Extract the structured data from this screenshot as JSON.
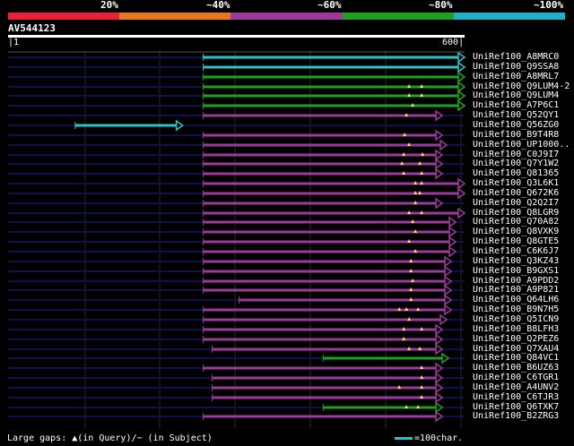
{
  "legend": {
    "segments": [
      {
        "label": "20%",
        "color": "#e8203a"
      },
      {
        "label": "~40%",
        "color": "#e87820"
      },
      {
        "label": "~60%",
        "color": "#9a3a9a"
      },
      {
        "label": "~80%",
        "color": "#20a020"
      },
      {
        "label": "~100%",
        "color": "#20b0c8"
      }
    ]
  },
  "query": {
    "name": "AV544123",
    "start": "1",
    "end": "600"
  },
  "hits": [
    {
      "name": "UniRef100_A8MRC0",
      "color": "cyan",
      "start": 218,
      "end": 510,
      "gaps": []
    },
    {
      "name": "UniRef100_Q9SSA8",
      "color": "cyan",
      "start": 218,
      "end": 510,
      "gaps": []
    },
    {
      "name": "UniRef100_A8MRL7",
      "color": "green",
      "start": 218,
      "end": 510,
      "gaps": []
    },
    {
      "name": "UniRef100_Q9LUM4-2",
      "color": "green",
      "start": 218,
      "end": 510,
      "gaps": [
        448,
        462
      ]
    },
    {
      "name": "UniRef100_Q9LUM4",
      "color": "green",
      "start": 218,
      "end": 510,
      "gaps": [
        448,
        462
      ]
    },
    {
      "name": "UniRef100_A7P6C1",
      "color": "green",
      "start": 218,
      "end": 510,
      "gaps": [
        452
      ]
    },
    {
      "name": "UniRef100_Q52QY1",
      "color": "purple",
      "start": 218,
      "end": 485,
      "gaps": [
        445
      ]
    },
    {
      "name": "UniRef100_Q56ZG0",
      "color": "cyan",
      "start": 75,
      "end": 195,
      "gaps": []
    },
    {
      "name": "UniRef100_B9T4R8",
      "color": "purple",
      "start": 218,
      "end": 485,
      "gaps": [
        443
      ]
    },
    {
      "name": "UniRef100_UP1000..",
      "color": "purple",
      "start": 218,
      "end": 490,
      "gaps": [
        448
      ]
    },
    {
      "name": "UniRef100_C0J9I7",
      "color": "purple",
      "start": 218,
      "end": 485,
      "gaps": [
        442,
        463
      ]
    },
    {
      "name": "UniRef100_Q7Y1W2",
      "color": "purple",
      "start": 218,
      "end": 485,
      "gaps": [
        440,
        460
      ]
    },
    {
      "name": "UniRef100_Q81365",
      "color": "purple",
      "start": 218,
      "end": 485,
      "gaps": [
        442,
        462
      ]
    },
    {
      "name": "UniRef100_Q3L6K1",
      "color": "purple",
      "start": 218,
      "end": 510,
      "gaps": [
        455,
        462
      ]
    },
    {
      "name": "UniRef100_Q672K6",
      "color": "purple",
      "start": 218,
      "end": 510,
      "gaps": [
        455,
        460
      ]
    },
    {
      "name": "UniRef100_Q2Q2I7",
      "color": "purple",
      "start": 218,
      "end": 485,
      "gaps": [
        455
      ]
    },
    {
      "name": "UniRef100_Q8LGR9",
      "color": "purple",
      "start": 218,
      "end": 510,
      "gaps": [
        448,
        462
      ]
    },
    {
      "name": "UniRef100_Q70A82",
      "color": "purple",
      "start": 218,
      "end": 500,
      "gaps": [
        452
      ]
    },
    {
      "name": "UniRef100_Q8VXK9",
      "color": "purple",
      "start": 218,
      "end": 500,
      "gaps": [
        455
      ]
    },
    {
      "name": "UniRef100_Q8GTE5",
      "color": "purple",
      "start": 218,
      "end": 500,
      "gaps": [
        448
      ]
    },
    {
      "name": "UniRef100_C6K6J7",
      "color": "purple",
      "start": 218,
      "end": 500,
      "gaps": [
        455
      ]
    },
    {
      "name": "UniRef100_Q3KZ43",
      "color": "purple",
      "start": 218,
      "end": 495,
      "gaps": [
        450
      ]
    },
    {
      "name": "UniRef100_B9GXS1",
      "color": "purple",
      "start": 218,
      "end": 495,
      "gaps": [
        450
      ]
    },
    {
      "name": "UniRef100_A9PDD2",
      "color": "purple",
      "start": 218,
      "end": 495,
      "gaps": [
        452
      ]
    },
    {
      "name": "UniRef100_A9P821",
      "color": "purple",
      "start": 218,
      "end": 495,
      "gaps": [
        450
      ]
    },
    {
      "name": "UniRef100_Q64LH6",
      "color": "purple",
      "start": 258,
      "end": 495,
      "gaps": [
        450
      ]
    },
    {
      "name": "UniRef100_B9N7H5",
      "color": "purple",
      "start": 218,
      "end": 495,
      "gaps": [
        437,
        445,
        458
      ]
    },
    {
      "name": "UniRef100_Q5ICN9",
      "color": "purple",
      "start": 218,
      "end": 490,
      "gaps": [
        448
      ]
    },
    {
      "name": "UniRef100_B8LFH3",
      "color": "purple",
      "start": 218,
      "end": 485,
      "gaps": [
        442,
        462
      ]
    },
    {
      "name": "UniRef100_Q2PEZ6",
      "color": "purple",
      "start": 218,
      "end": 485,
      "gaps": [
        442
      ]
    },
    {
      "name": "UniRef100_Q7XAU4",
      "color": "purple",
      "start": 228,
      "end": 485,
      "gaps": [
        448,
        460
      ]
    },
    {
      "name": "UniRef100_Q84VC1",
      "color": "green",
      "start": 352,
      "end": 492,
      "gaps": []
    },
    {
      "name": "UniRef100_B6UZ63",
      "color": "purple",
      "start": 218,
      "end": 485,
      "gaps": [
        462
      ]
    },
    {
      "name": "UniRef100_C6TGR1",
      "color": "purple",
      "start": 228,
      "end": 485,
      "gaps": [
        462
      ]
    },
    {
      "name": "UniRef100_A4UNV2",
      "color": "purple",
      "start": 228,
      "end": 485,
      "gaps": [
        437,
        462
      ]
    },
    {
      "name": "UniRef100_C6TJR3",
      "color": "purple",
      "start": 228,
      "end": 485,
      "gaps": [
        462
      ]
    },
    {
      "name": "UniRef100_Q6TXK7",
      "color": "green",
      "start": 352,
      "end": 485,
      "gaps": [
        445,
        458
      ]
    },
    {
      "name": "UniRef100_B2ZRG3",
      "color": "purple",
      "start": 218,
      "end": 485,
      "gaps": []
    }
  ],
  "colors": {
    "cyan": "#30c0c8",
    "green": "#20a020",
    "purple": "#9a3a9a",
    "track": "#101050",
    "grid": "#2a2a2a"
  },
  "footer": {
    "gaps_text": "Large gaps: ▲(in Query)/− (in Subject)",
    "scale_text": "=100char."
  }
}
